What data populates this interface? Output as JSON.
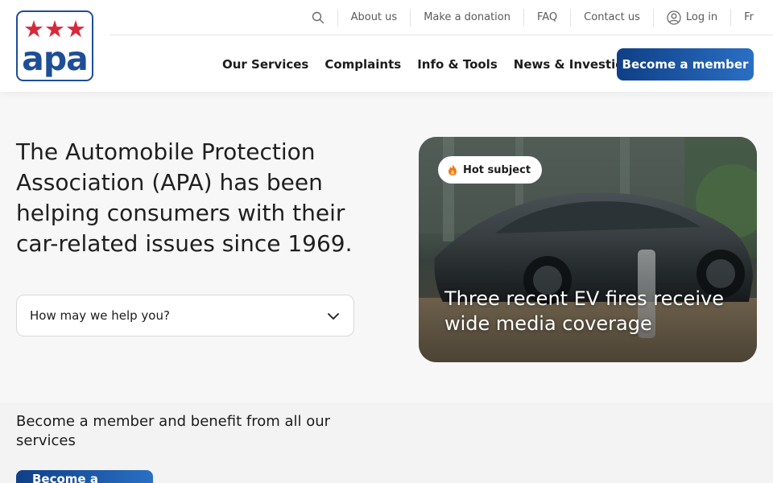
{
  "logo": {
    "stars": "★★★",
    "text": "apa"
  },
  "topbar": {
    "items": [
      "About us",
      "Make a donation",
      "FAQ",
      "Contact us"
    ],
    "login": "Log in",
    "language": "Fr"
  },
  "nav": {
    "links": [
      "Our Services",
      "Complaints",
      "Info & Tools",
      "News & Investigations"
    ],
    "cta": "Become a member"
  },
  "hero": {
    "title": "The Automobile Protection Association (APA) has been helping consumers with their car-related issues since 1969.",
    "select_label": "How may we help you?"
  },
  "card": {
    "badge": "Hot subject",
    "title": "Three recent EV fires receive wide media coverage"
  },
  "member": {
    "text": "Become a member and benefit from all our services",
    "cta": "Become a member"
  },
  "colors": {
    "brand_blue": "#1e4e96",
    "brand_red": "#d62a3c",
    "badge_flame": "#f07a1a"
  },
  "icons": [
    "search-icon",
    "user-icon",
    "chevron-down-icon",
    "fire-icon"
  ]
}
